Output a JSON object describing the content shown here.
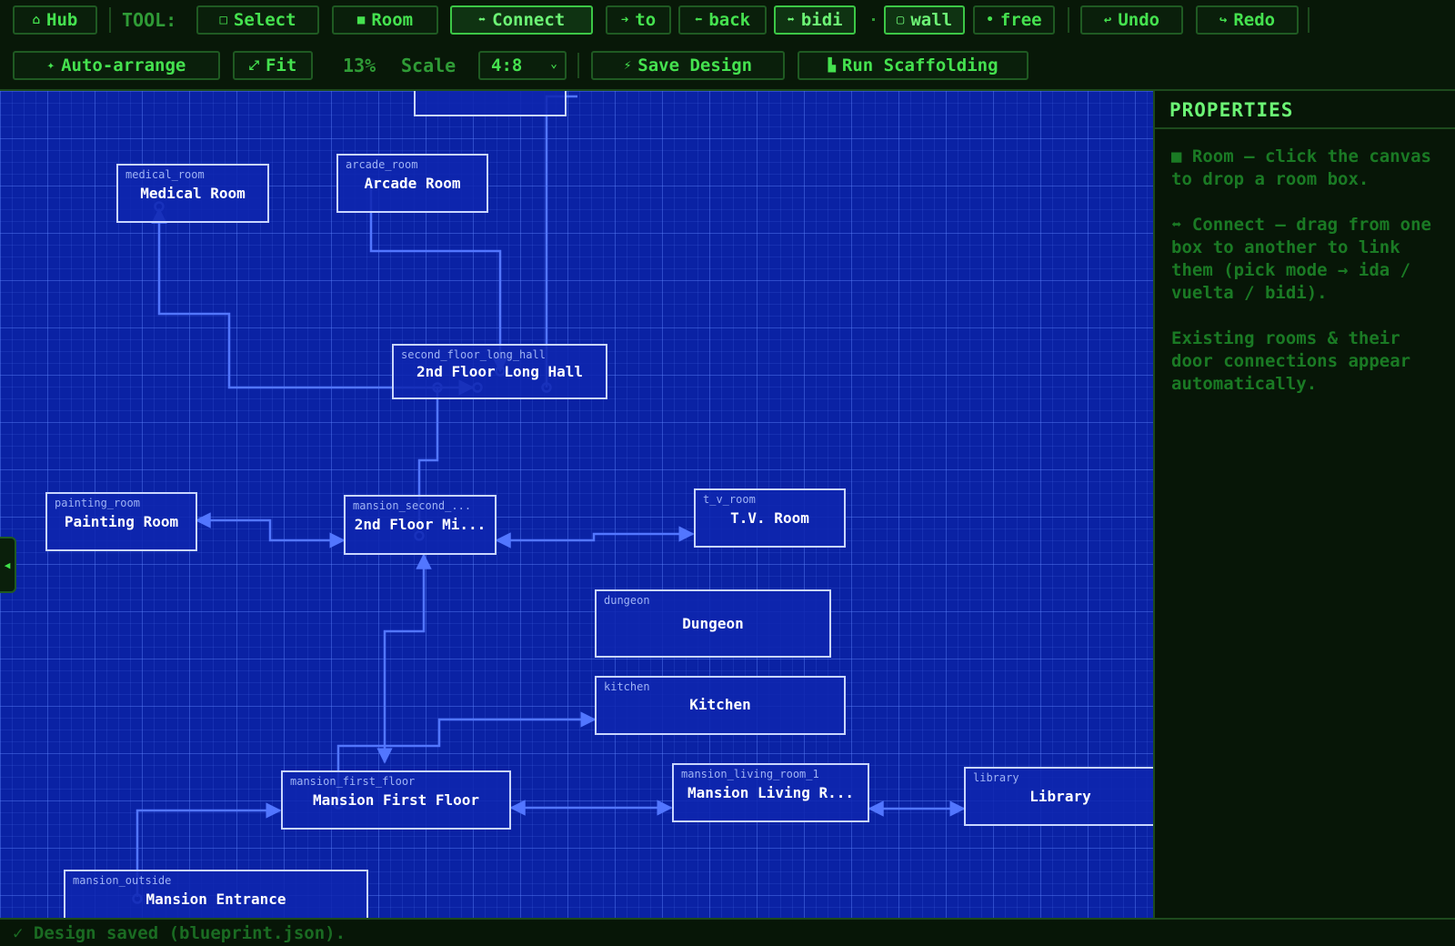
{
  "toolbar": {
    "hub_icon": "home-icon",
    "hub": "Hub",
    "tool_label": "TOOL:",
    "select": "Select",
    "room": "Room",
    "connect": "Connect",
    "to": "to",
    "back": "back",
    "bidi": "bidi",
    "wall": "wall",
    "free": "free",
    "undo": "Undo",
    "redo": "Redo",
    "auto_arrange": "Auto-arrange",
    "fit": "Fit",
    "zoom": "13%",
    "scale_label": "Scale",
    "scale_value": "4:8",
    "save_design": "Save Design",
    "run_scaffolding": "Run Scaffolding",
    "active_tool": "Connect",
    "active_mode": "bidi",
    "active_snap": "wall"
  },
  "canvas": {
    "rooms": [
      {
        "id": "medical_room",
        "name": "Medical Room"
      },
      {
        "id": "arcade_room",
        "name": "Arcade Room"
      },
      {
        "id": "second_floor_long_hall",
        "name": "2nd Floor Long Hall"
      },
      {
        "id": "painting_room",
        "name": "Painting Room"
      },
      {
        "id": "mansion_second_...",
        "name": "2nd Floor Mi..."
      },
      {
        "id": "t_v_room",
        "name": "T.V. Room"
      },
      {
        "id": "dungeon",
        "name": "Dungeon"
      },
      {
        "id": "kitchen",
        "name": "Kitchen"
      },
      {
        "id": "mansion_first_floor",
        "name": "Mansion First Floor"
      },
      {
        "id": "mansion_living_room_1",
        "name": "Mansion Living R..."
      },
      {
        "id": "library",
        "name": "Library"
      },
      {
        "id": "mansion_outside",
        "name": "Mansion Entrance"
      },
      {
        "id": "",
        "name": ""
      }
    ]
  },
  "properties": {
    "title": "PROPERTIES",
    "hint_room": "■ Room — click the canvas to drop a room box.",
    "hint_connect": "⬌ Connect — drag from one box to another to link them (pick mode → ida / vuelta / bidi).",
    "hint_existing": "Existing rooms & their door connections appear automatically."
  },
  "status": {
    "message": "✓ Design saved (blueprint.json)."
  },
  "colors": {
    "accent_green": "#45e24f",
    "canvas_blue": "#0a22a4",
    "link_blue": "#4f72ff"
  }
}
